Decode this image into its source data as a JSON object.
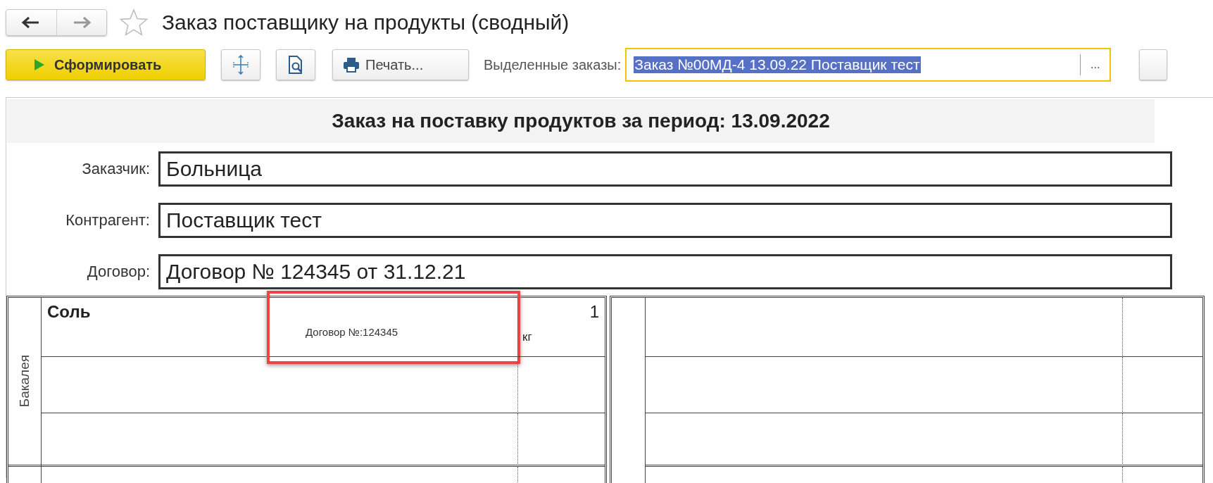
{
  "window": {
    "title": "Заказ поставщику на продукты (сводный)",
    "favorite": false
  },
  "toolbar": {
    "generate_button": "Сформировать",
    "print_button": "Печать...",
    "selected_orders": {
      "label": "Выделенные заказы:",
      "value": "Заказ №00МД-4 13.09.22 Поставщик тест",
      "text_selected": true,
      "focused": true,
      "choose_button": "..."
    }
  },
  "report": {
    "title": "Заказ на поставку продуктов за период: 13.09.2022",
    "fields": [
      {
        "label": "Заказчик:",
        "value": "Больница"
      },
      {
        "label": "Контрагент:",
        "value": "Поставщик тест"
      },
      {
        "label": "Договор:",
        "value": "Договор № 124345 от 31.12.21"
      }
    ],
    "table": {
      "group": "Бакалея",
      "rows": [
        {
          "product": "Соль",
          "note": "Договор №:124345",
          "quantity": "1",
          "unit": "кг",
          "highlighted": true
        }
      ]
    }
  }
}
